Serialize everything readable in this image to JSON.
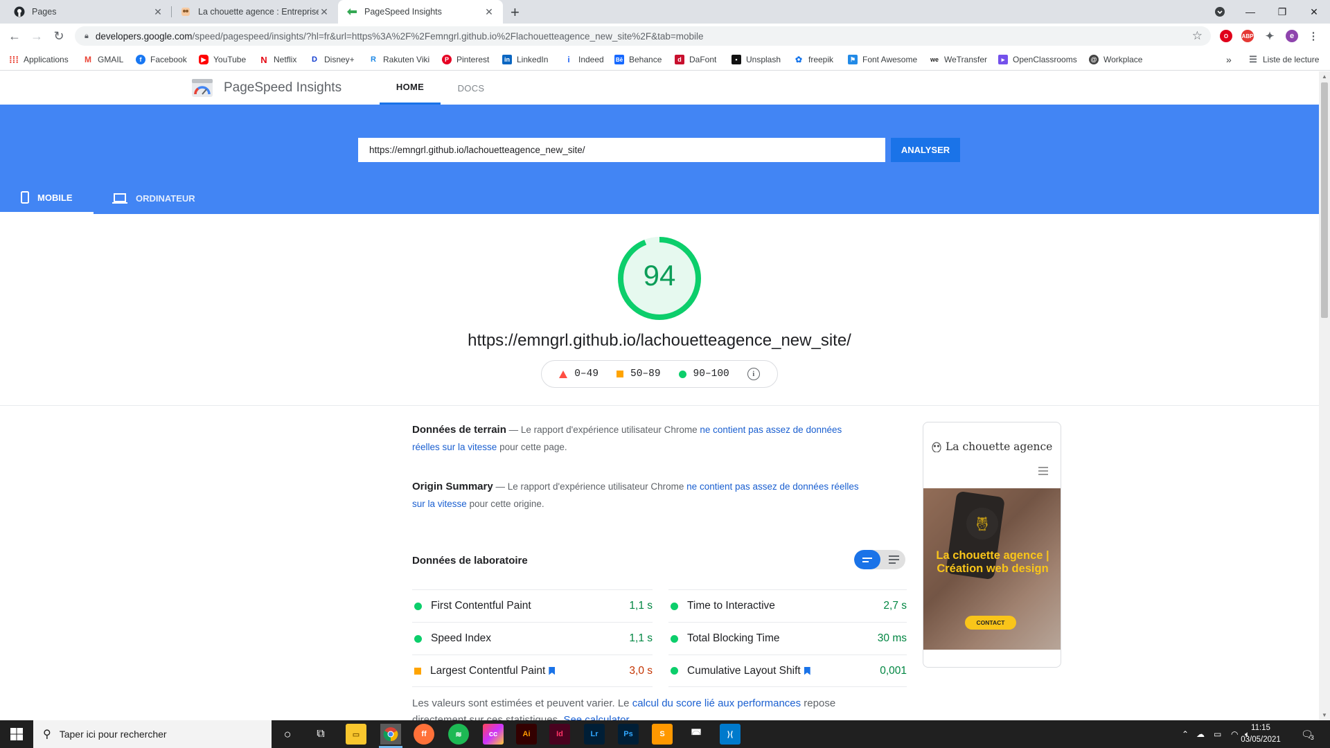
{
  "browser": {
    "tabs": [
      {
        "title": "Pages",
        "icon": "github-icon"
      },
      {
        "title": "La chouette agence : Entreprise w",
        "icon": "owl-icon"
      },
      {
        "title": "PageSpeed Insights",
        "icon": "pagespeed-icon"
      }
    ],
    "url_host": "developers.google.com",
    "url_rest": "/speed/pagespeed/insights/?hl=fr&url=https%3A%2F%2Femngrl.github.io%2Flachouetteagence_new_site%2F&tab=mobile",
    "bookmarks": [
      {
        "label": "Applications",
        "color": "#ea4335"
      },
      {
        "label": "GMAIL",
        "color": "#ea4335"
      },
      {
        "label": "Facebook",
        "color": "#1877f2"
      },
      {
        "label": "YouTube",
        "color": "#ff0000"
      },
      {
        "label": "Netflix",
        "color": "#e50914"
      },
      {
        "label": "Disney+",
        "color": "#113ccf"
      },
      {
        "label": "Rakuten Viki",
        "color": "#1e88e5"
      },
      {
        "label": "Pinterest",
        "color": "#e60023"
      },
      {
        "label": "LinkedIn",
        "color": "#0a66c2"
      },
      {
        "label": "Indeed",
        "color": "#2164f3"
      },
      {
        "label": "Behance",
        "color": "#1769ff"
      },
      {
        "label": "DaFont",
        "color": "#c8102e"
      },
      {
        "label": "Unsplash",
        "color": "#111111"
      },
      {
        "label": "freepik",
        "color": "#1273eb"
      },
      {
        "label": "Font Awesome",
        "color": "#228ae6"
      },
      {
        "label": "WeTransfer",
        "color": "#222222"
      },
      {
        "label": "OpenClassrooms",
        "color": "#7451eb"
      },
      {
        "label": "Workplace",
        "color": "#444444"
      }
    ],
    "bookmarks_more": "»",
    "reading_list": "Liste de lecture",
    "profile_initial": "e"
  },
  "psi": {
    "title": "PageSpeed Insights",
    "nav_home": "HOME",
    "nav_docs": "DOCS",
    "url_value": "https://emngrl.github.io/lachouetteagence_new_site/",
    "analyse": "ANALYSER",
    "tab_mobile": "MOBILE",
    "tab_desktop": "ORDINATEUR",
    "score": "94",
    "score_fraction": 0.94,
    "tested_url": "https://emngrl.github.io/lachouetteagence_new_site/",
    "legend": {
      "fail": "0–49",
      "average": "50–89",
      "pass": "90–100"
    },
    "field": {
      "title": "Données de terrain",
      "pre": " — Le rapport d'expérience utilisateur Chrome ",
      "link": "ne contient pas assez de données réelles sur la vitesse",
      "post": " pour cette page."
    },
    "origin": {
      "title": "Origin Summary",
      "pre": " — Le rapport d'expérience utilisateur Chrome ",
      "link": "ne contient pas assez de données réelles sur la vitesse",
      "post": " pour cette origine."
    },
    "lab_title": "Données de laboratoire",
    "metrics_left": [
      {
        "name": "First Contentful Paint",
        "value": "1,1 s",
        "status": "good",
        "flag": false
      },
      {
        "name": "Speed Index",
        "value": "1,1 s",
        "status": "good",
        "flag": false
      },
      {
        "name": "Largest Contentful Paint",
        "value": "3,0 s",
        "status": "avg",
        "flag": true
      }
    ],
    "metrics_right": [
      {
        "name": "Time to Interactive",
        "value": "2,7 s",
        "status": "good",
        "flag": false
      },
      {
        "name": "Total Blocking Time",
        "value": "30 ms",
        "status": "good",
        "flag": false
      },
      {
        "name": "Cumulative Layout Shift",
        "value": "0,001",
        "status": "good",
        "flag": true
      }
    ],
    "footnote_pre": "Les valeurs sont estimées et peuvent varier. Le ",
    "footnote_link": "calcul du score lié aux performances",
    "footnote_post": " repose directement sur ces statistiques. ",
    "footnote_link2": "See calculator.",
    "preview": {
      "brand": "La chouette agence",
      "headline": "La chouette agence | Création web design",
      "cta": "CONTACT"
    }
  },
  "taskbar": {
    "search_placeholder": "Taper ici pour rechercher",
    "time": "11:15",
    "date": "03/05/2021",
    "notifications": "3"
  }
}
